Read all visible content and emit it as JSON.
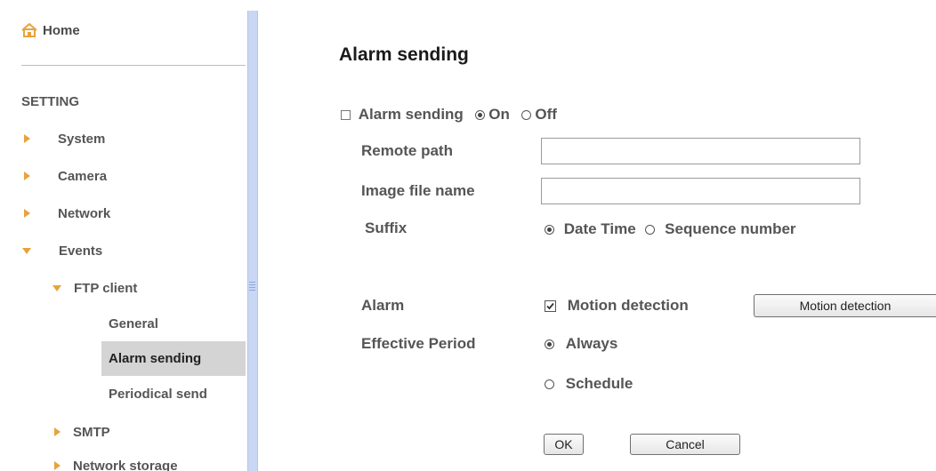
{
  "sidebar": {
    "home_label": "Home",
    "section_label": "SETTING",
    "items": [
      {
        "label": "System"
      },
      {
        "label": "Camera"
      },
      {
        "label": "Network"
      },
      {
        "label": "Events"
      },
      {
        "label": "FTP client"
      },
      {
        "label": "General"
      },
      {
        "label": "Alarm sending"
      },
      {
        "label": "Periodical send"
      },
      {
        "label": "SMTP"
      },
      {
        "label": "Network storage"
      }
    ],
    "selected_item": "Alarm sending"
  },
  "main": {
    "title": "Alarm sending",
    "alarm_sending": {
      "label": "Alarm sending",
      "on_label": "On",
      "off_label": "Off",
      "selected": "On"
    },
    "remote_path": {
      "label": "Remote path",
      "value": ""
    },
    "image_file_name": {
      "label": "Image file name",
      "value": ""
    },
    "suffix": {
      "label": "Suffix",
      "options": [
        "Date Time",
        "Sequence number"
      ],
      "selected": "Date Time"
    },
    "alarm": {
      "label": "Alarm",
      "checkbox_label": "Motion detection",
      "checked": true,
      "button_label": "Motion detection"
    },
    "effective_period": {
      "label": "Effective Period",
      "options": [
        "Always",
        "Schedule"
      ],
      "selected": "Always"
    },
    "ok_label": "OK",
    "cancel_label": "Cancel"
  },
  "colors": {
    "accent_triangle": "#e8a33c",
    "selected_bg": "#d4d4d4",
    "scrollbar": "#c9d7f5"
  }
}
